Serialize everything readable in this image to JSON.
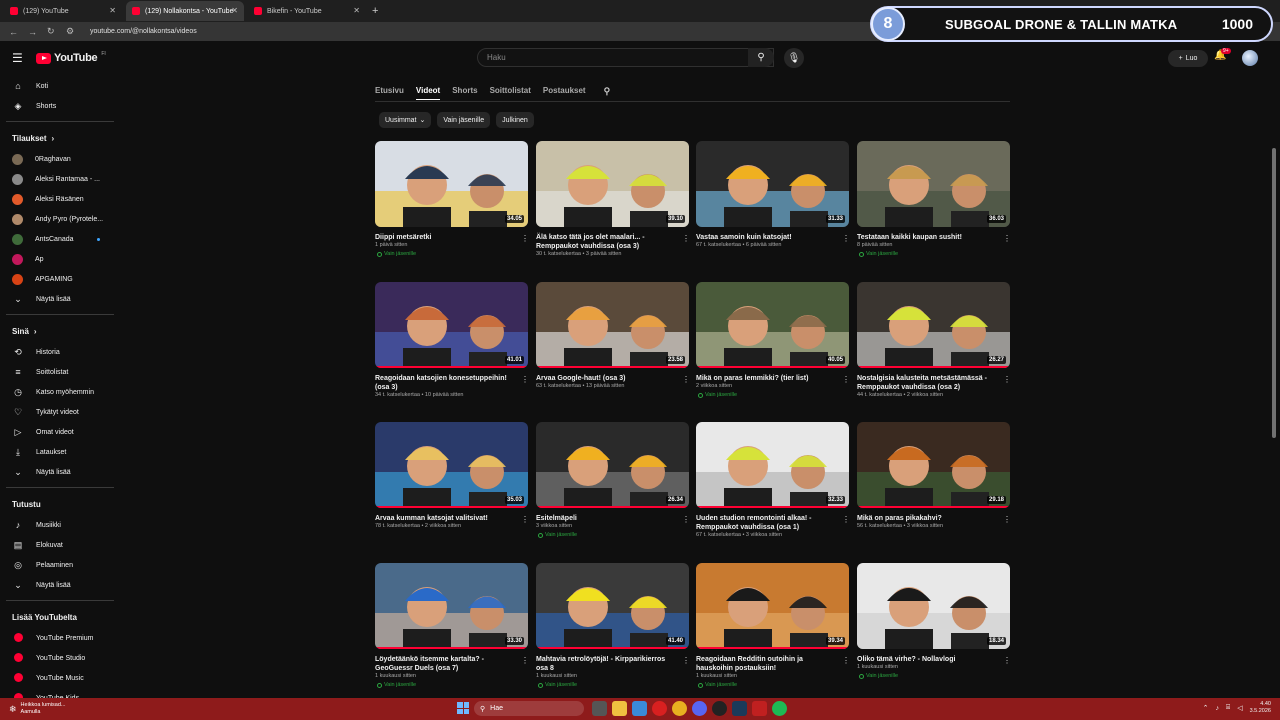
{
  "browser": {
    "tabs": [
      {
        "label": "(129) YouTube",
        "active": false
      },
      {
        "label": "(129) Nollakontsa - YouTube",
        "active": true
      },
      {
        "label": "Bikefin - YouTube",
        "active": false
      }
    ],
    "newtab_icon": "plus-icon",
    "url": "youtube.com/@nollakontsa/videos"
  },
  "overlay": {
    "badge": "8",
    "title": "SUBGOAL DRONE & TALLIN MATKA",
    "count": "1000"
  },
  "header": {
    "logo_text": "YouTube",
    "logo_sup": "FI",
    "search_placeholder": "Haku",
    "create_label": "Luo",
    "notif_badge": "9+"
  },
  "sidebar": {
    "main": [
      {
        "icon": "home-icon",
        "glyph": "⌂",
        "label": "Koti"
      },
      {
        "icon": "shorts-icon",
        "glyph": "◈",
        "label": "Shorts"
      }
    ],
    "subs_title": "Tilaukset",
    "subs": [
      {
        "label": "0Raghavan",
        "color": "#7a6a55",
        "dot": false
      },
      {
        "label": "Aleksi Rantamaa - ...",
        "color": "#8a8a8a",
        "dot": false
      },
      {
        "label": "Aleksi Räsänen",
        "color": "#e25a2a",
        "dot": false
      },
      {
        "label": "Andy Pyro (Pyrotele...",
        "color": "#b08a6a",
        "dot": false
      },
      {
        "label": "AntsCanada",
        "color": "#3f6b3a",
        "dot": true
      },
      {
        "label": "Ap",
        "color": "#c2185b",
        "dot": false
      },
      {
        "label": "APGAMING",
        "color": "#d84315",
        "dot": false
      }
    ],
    "subs_more": "Näytä lisää",
    "you_title": "Sinä",
    "you": [
      {
        "icon": "history-icon",
        "glyph": "⟲",
        "label": "Historia"
      },
      {
        "icon": "playlist-icon",
        "glyph": "≡",
        "label": "Soittolistat"
      },
      {
        "icon": "watch-later-icon",
        "glyph": "◷",
        "label": "Katso myöhemmin"
      },
      {
        "icon": "like-icon",
        "glyph": "♡",
        "label": "Tykätyt videot"
      },
      {
        "icon": "your-videos-icon",
        "glyph": "▷",
        "label": "Omat videot"
      },
      {
        "icon": "download-icon",
        "glyph": "⤓",
        "label": "Lataukset"
      },
      {
        "icon": "chevron-down-icon",
        "glyph": "⌄",
        "label": "Näytä lisää"
      }
    ],
    "explore_title": "Tutustu",
    "explore": [
      {
        "icon": "music-icon",
        "glyph": "♪",
        "label": "Musiikki"
      },
      {
        "icon": "movies-icon",
        "glyph": "▤",
        "label": "Elokuvat"
      },
      {
        "icon": "gaming-icon",
        "glyph": "◎",
        "label": "Pelaaminen"
      },
      {
        "icon": "chevron-down-icon",
        "glyph": "⌄",
        "label": "Näytä lisää"
      }
    ],
    "more_title": "Lisää YouTubelta",
    "more": [
      {
        "icon": "youtube-premium-icon",
        "label": "YouTube Premium"
      },
      {
        "icon": "youtube-studio-icon",
        "label": "YouTube Studio"
      },
      {
        "icon": "youtube-music-icon",
        "label": "YouTube Music"
      },
      {
        "icon": "youtube-kids-icon",
        "label": "YouTube Kids"
      }
    ]
  },
  "channel_tabs": [
    "Etusivu",
    "Videot",
    "Shorts",
    "Soittolistat",
    "Postaukset"
  ],
  "active_tab": "Videot",
  "chips": [
    {
      "label": "Uusimmat",
      "dropdown": true
    },
    {
      "label": "Vain jäsenille",
      "dropdown": false
    },
    {
      "label": "Julkinen",
      "dropdown": false
    }
  ],
  "members_label": "Vain jäsenille",
  "videos": [
    {
      "title": "Diippi metsäretki",
      "meta": "1 päivä sitten",
      "duration": "34.05",
      "members": true,
      "palette": [
        "#d8dde4",
        "#2a3a52",
        "#f0c020"
      ],
      "progress": 0
    },
    {
      "title": "Älä katso tätä jos olet maalari... - Remppaukot vauhdissa (osa 3)",
      "meta": "30 t. katselukertaa • 3 päivää sitten",
      "duration": "39.10",
      "members": false,
      "palette": [
        "#c8c0a8",
        "#d6e23a",
        "#e8e8e8"
      ],
      "progress": 0
    },
    {
      "title": "Vastaa samoin kuin katsojat!",
      "meta": "67 t. katselukertaa • 6 päivää sitten",
      "duration": "31.33",
      "members": false,
      "palette": [
        "#2a2a2a",
        "#f0b020",
        "#7ed0ff"
      ],
      "progress": 0
    },
    {
      "title": "Testataan kaikki kaupan sushit!",
      "meta": "8 päivää sitten",
      "duration": "36.03",
      "members": true,
      "palette": [
        "#6a6a5a",
        "#c89a50",
        "#3c4a3a"
      ],
      "progress": 0
    },
    {
      "title": "Reagoidaan katsojien konesetuppeihin! (osa 3)",
      "meta": "34 t. katselukertaa • 10 päivää sitten",
      "duration": "41.01",
      "members": false,
      "palette": [
        "#3a2a5a",
        "#c86a3a",
        "#4a6ac8"
      ],
      "progress": 1
    },
    {
      "title": "Arvaa Google-haut! (osa 3)",
      "meta": "63 t. katselukertaa • 13 päivää sitten",
      "duration": "23.58",
      "members": false,
      "palette": [
        "#5a4a3a",
        "#e8a040",
        "#ffffff"
      ],
      "progress": 1
    },
    {
      "title": "Mikä on paras lemmikki? (tier list)",
      "meta": "2 viikkoa sitten",
      "duration": "40.05",
      "members": true,
      "palette": [
        "#4a5a3a",
        "#8a6a4a",
        "#c8c8a8"
      ],
      "progress": 1
    },
    {
      "title": "Nostalgisia kalusteita metsästämässä - Remppaukot vauhdissa (osa 2)",
      "meta": "44 t. katselukertaa • 2 viikkoa sitten",
      "duration": "26.27",
      "members": false,
      "palette": [
        "#3a3530",
        "#d6e23a",
        "#e8e8e8"
      ],
      "progress": 1
    },
    {
      "title": "Arvaa kumman katsojat valitsivat!",
      "meta": "78 t. katselukertaa • 2 viikkoa sitten",
      "duration": "35.03",
      "members": false,
      "palette": [
        "#2a3a6a",
        "#e8c060",
        "#3ab0e8"
      ],
      "progress": 1
    },
    {
      "title": "Esitelmäpeli",
      "meta": "3 viikkoa sitten",
      "duration": "26.34",
      "members": true,
      "palette": [
        "#2a2a2a",
        "#f0b020",
        "#8a8a8a"
      ],
      "progress": 1
    },
    {
      "title": "Uuden studion remontointi alkaa! - Remppaukot vauhdissa (osa 1)",
      "meta": "67 t. katselukertaa • 3 viikkoa sitten",
      "duration": "32.33",
      "members": false,
      "palette": [
        "#e8e8e8",
        "#d6e23a",
        "#a8a8a8"
      ],
      "progress": 1
    },
    {
      "title": "Mikä on paras pikakahvi?",
      "meta": "56 t. katselukertaa • 3 viikkoa sitten",
      "duration": "29.18",
      "members": false,
      "palette": [
        "#3a2a20",
        "#c86a20",
        "#3a6a3a"
      ],
      "progress": 1
    },
    {
      "title": "Löydetäänkö itsemme kartalta? - GeoGuessr Duels (osa 7)",
      "meta": "1 kuukausi sitten",
      "duration": "33.30",
      "members": true,
      "palette": [
        "#4a6a8a",
        "#2a6ac8",
        "#e8c0a0"
      ],
      "progress": 1
    },
    {
      "title": "Mahtavia retrolöytöjä! - Kirpparikierros osa 8",
      "meta": "1 kuukausi sitten",
      "duration": "41.40",
      "members": true,
      "palette": [
        "#3a3a3a",
        "#f0e020",
        "#2a6ac8"
      ],
      "progress": 1
    },
    {
      "title": "Reagoidaan Redditin outoihin ja hauskoihin postauksiin!",
      "meta": "1 kuukausi sitten",
      "duration": "39.34",
      "members": true,
      "palette": [
        "#c87a30",
        "#1a1a1a",
        "#e8b070"
      ],
      "progress": 1
    },
    {
      "title": "Oliko tämä virhe? - Nollavlogi",
      "meta": "1 kuukausi sitten",
      "duration": "18.34",
      "members": true,
      "palette": [
        "#e8e8e8",
        "#1a1a1a",
        "#c8c8c8"
      ],
      "progress": 0
    }
  ],
  "taskbar": {
    "weather_line1": "Heikkoa lumisad...",
    "weather_line2": "Aamulla",
    "search_label": "Hae",
    "time": "4.40",
    "date": "3.5.2026"
  }
}
